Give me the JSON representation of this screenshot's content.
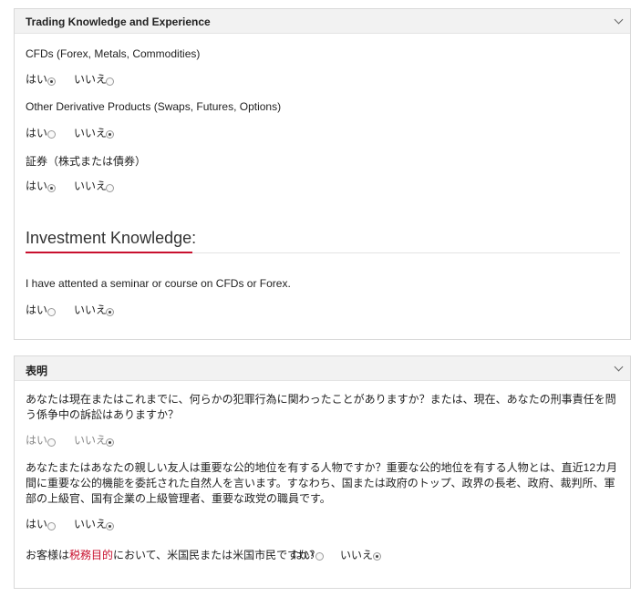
{
  "panel1": {
    "title": "Trading Knowledge and Experience",
    "questions": [
      {
        "label": "CFDs (Forex, Metals, Commodities)",
        "yes": "はい",
        "no": "いいえ",
        "selected": "yes"
      },
      {
        "label": "Other Derivative Products (Swaps, Futures, Options)",
        "yes": "はい",
        "no": "いいえ",
        "selected": "no"
      },
      {
        "label": "証券（株式または債券）",
        "yes": "はい",
        "no": "いいえ",
        "selected": "yes"
      }
    ],
    "investment": {
      "heading": "Investment Knowledge:",
      "question": {
        "label": "I have attented a seminar or course on CFDs or Forex.",
        "yes": "はい",
        "no": "いいえ",
        "selected": "no"
      }
    }
  },
  "panel2": {
    "title": "表明",
    "q1": {
      "label": "あなたは現在またはこれまでに、何らかの犯罪行為に関わったことがありますか？または、現在、あなたの刑事責任を問う係争中の訴訟はありますか？",
      "yes": "はい",
      "no": "いいえ",
      "selected": "no"
    },
    "q2": {
      "label": "あなたまたはあなたの親しい友人は重要な公的地位を有する人物ですか？重要な公的地位を有する人物とは、直近12カ月間に重要な公的機能を委託された自然人を言います。すなわち、国または政府のトップ、政界の長老、政府、裁判所、軍部の上級官、国有企業の上級管理者、重要な政党の職員です。",
      "yes": "はい",
      "no": "いいえ",
      "selected": "no"
    },
    "q3": {
      "prefix": "お客様は",
      "emphasis": "税務目的",
      "suffix": "において、米国民または米国市民ですか？",
      "yes": "はい",
      "no": "いいえ",
      "selected": "no"
    }
  },
  "colors": {
    "accent": "#c8102e",
    "header_bg": "#f2f2f2",
    "border": "#d9d9d9"
  }
}
